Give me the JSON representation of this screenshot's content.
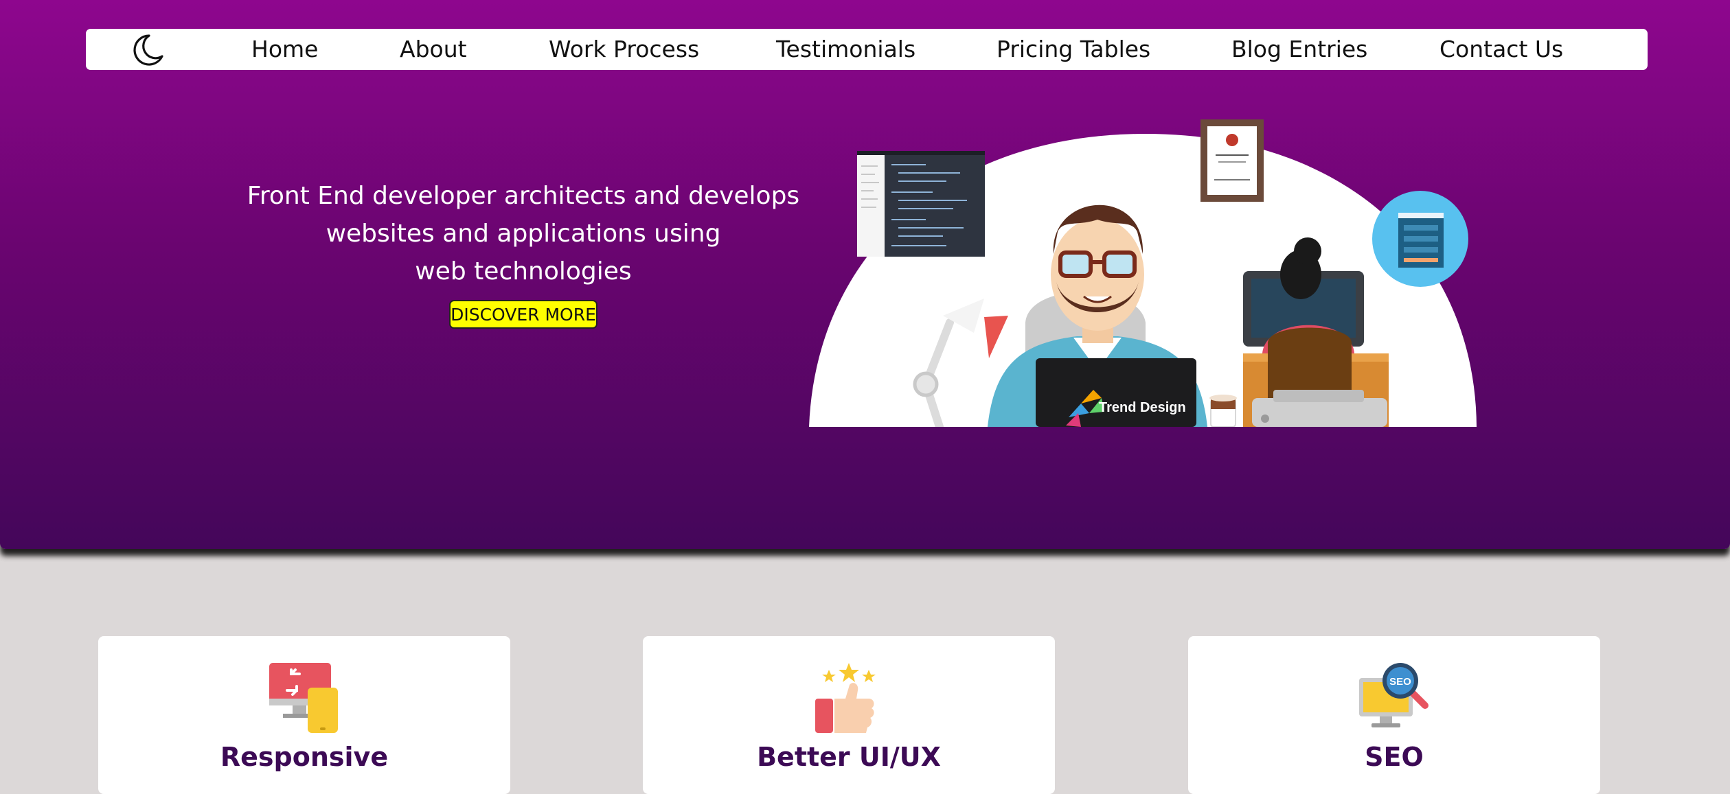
{
  "nav": {
    "logo_icon": "moon-icon",
    "items": [
      {
        "label": "Home"
      },
      {
        "label": "About"
      },
      {
        "label": "Work Process"
      },
      {
        "label": "Testimonials"
      },
      {
        "label": "Pricing Tables"
      },
      {
        "label": "Blog Entries"
      },
      {
        "label": "Contact Us"
      }
    ]
  },
  "hero": {
    "lines": [
      "Front End developer architects and develops",
      "websites and applications using",
      "web technologies"
    ],
    "cta_label": "DISCOVER MORE",
    "laptop_label": "Trend Design",
    "colors": {
      "gradient_top": "#8e068e",
      "gradient_bottom": "#44065a",
      "cta": "#ffff00"
    }
  },
  "features": [
    {
      "title": "Responsive",
      "icon": "responsive-devices-icon"
    },
    {
      "title": "Better UI/UX",
      "icon": "thumbs-up-stars-icon"
    },
    {
      "title": "SEO",
      "icon": "seo-magnifier-icon"
    }
  ],
  "colors": {
    "page_bg": "#dcd8d8",
    "card_title": "#3c0a55"
  }
}
